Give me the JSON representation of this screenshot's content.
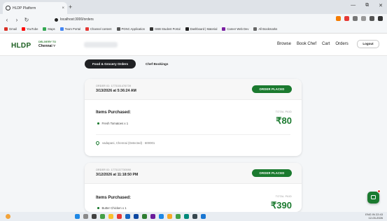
{
  "browser": {
    "tab_title": "HLDP Platform",
    "tab_close": "×",
    "new_tab": "+",
    "url": "localhost:3000/orders",
    "window_controls": [
      "—",
      "⧉",
      "✕"
    ],
    "nav": {
      "back": "‹",
      "forward": "›",
      "reload": "↻"
    }
  },
  "bookmarks": [
    {
      "label": "Gmail",
      "color": "#d93025"
    },
    {
      "label": "YouTube",
      "color": "#ff0000"
    },
    {
      "label": "Maps",
      "color": "#34a853"
    },
    {
      "label": "Team Portal",
      "color": "#4285f4"
    },
    {
      "label": "Channel content",
      "color": "#e53935"
    },
    {
      "label": "PGNC Application",
      "color": "#555555"
    },
    {
      "label": "GBB Student Portal",
      "color": "#333333"
    },
    {
      "label": "Dashboard | Material",
      "color": "#222222"
    },
    {
      "label": "Career Web Dev",
      "color": "#7b1fa2"
    },
    {
      "label": "All Bookmarks",
      "color": "#666666"
    }
  ],
  "header": {
    "logo": "HLDP",
    "delivery_label": "DELIVERY TO",
    "delivery_city": "Chennai ˅",
    "nav": [
      "Browse",
      "Book Chef",
      "Cart",
      "Orders"
    ],
    "logout": "Logout"
  },
  "tabs": {
    "active": "Food & Grocery Orders",
    "inactive": "Chef Bookings"
  },
  "orders": [
    {
      "order_id": "ORDER ID: 1773151476739",
      "date": "3/13/2026 at 5:36:24 AM",
      "status": "ORDER PLACED",
      "items_title": "Items Purchased:",
      "items": [
        "Fresh Tomatoes x 1"
      ],
      "paid_label": "TOTAL PAID",
      "total": "₹80",
      "address": "vadapani, Chennai (Detected) · 600001"
    },
    {
      "order_id": "ORDER ID: 1773137730590",
      "date": "3/12/2026 at 11:18:50 PM",
      "status": "ORDER PLACED",
      "items_title": "Items Purchased:",
      "items": [
        "Butter Chicken x 1"
      ],
      "paid_label": "TOTAL PAID",
      "total": "₹390"
    }
  ],
  "taskbar": {
    "time": "22:43",
    "date": "12-03-2026",
    "lang": "ENG IN"
  }
}
